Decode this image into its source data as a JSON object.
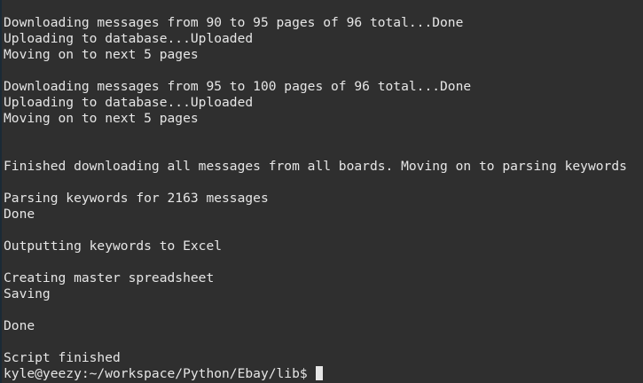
{
  "terminal": {
    "lines": [
      "Downloading messages from 90 to 95 pages of 96 total...Done",
      "Uploading to database...Uploaded",
      "Moving on to next 5 pages",
      "",
      "Downloading messages from 95 to 100 pages of 96 total...Done",
      "Uploading to database...Uploaded",
      "Moving on to next 5 pages",
      "",
      "",
      "Finished downloading all messages from all boards. Moving on to parsing keywords",
      "",
      "Parsing keywords for 2163 messages",
      "Done",
      "",
      "Outputting keywords to Excel",
      "",
      "Creating master spreadsheet",
      "Saving",
      "",
      "Done",
      "",
      "Script finished"
    ],
    "prompt": "kyle@yeezy:~/workspace/Python/Ebay/lib$"
  }
}
